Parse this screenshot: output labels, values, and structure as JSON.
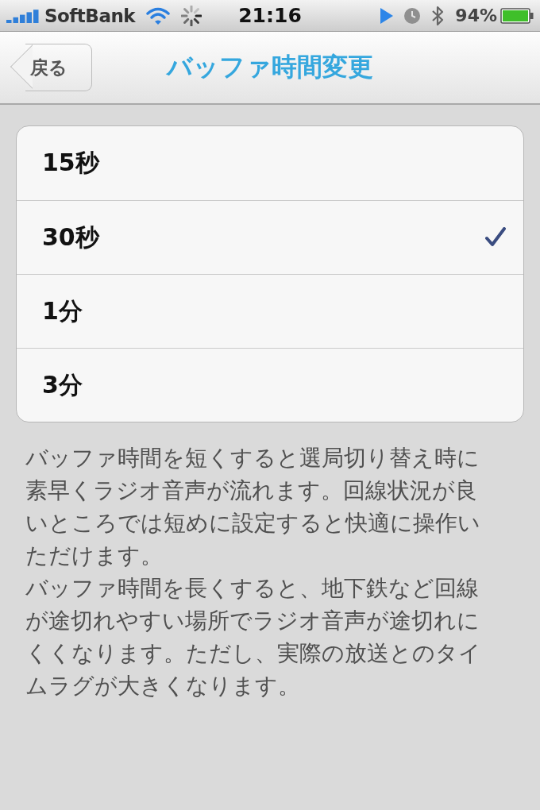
{
  "status_bar": {
    "carrier": "SoftBank",
    "time": "21:16",
    "battery": "94%"
  },
  "nav_bar": {
    "back_button": "戻る",
    "title": "バッファ時間変更"
  },
  "options": [
    {
      "label": "15秒",
      "selected": false
    },
    {
      "label": "30秒",
      "selected": true
    },
    {
      "label": "1分",
      "selected": false
    },
    {
      "label": "3分",
      "selected": false
    }
  ],
  "footer": [
    "バッファ時間を短くすると選局切り替え時に素早くラジオ音声が流れます。回線状況が良いところでは短めに設定すると快適に操作いただけます。",
    "バッファ時間を長くすると、地下鉄など回線が途切れやすい場所でラジオ音声が途切れにくくなります。ただし、実際の放送とのタイムラグが大きくなります。"
  ]
}
